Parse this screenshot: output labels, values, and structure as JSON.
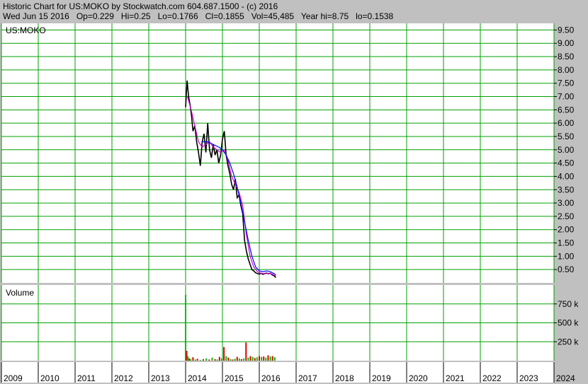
{
  "header": {
    "line1": "Historic Chart for US:MOKO by Stockwatch.com 604.687.1500 - (c) 2016",
    "line2": "Wed Jun 15 2016   Op=0.229   Hi=0.25   Lo=0.1766   Cl=0.1855   Vol=45,485   Year hi=8.75   lo=0.1538"
  },
  "colors": {
    "background": "#c0c0c0",
    "panel": "#ffffff",
    "grid": "#00a000",
    "price": "#000000",
    "ma_short": "#d000d0",
    "ma_long": "#0000ff",
    "volume_up": "#00c000",
    "volume_down": "#e00000"
  },
  "chart_data": [
    {
      "type": "line",
      "title": "US:MOKO",
      "x_unit": "year",
      "xlim": [
        2009,
        2024
      ],
      "ylim": [
        0,
        9.75
      ],
      "y_ticks": [
        "0.50",
        "1.00",
        "1.50",
        "2.00",
        "2.50",
        "3.00",
        "3.50",
        "4.00",
        "4.50",
        "5.00",
        "5.50",
        "6.00",
        "6.50",
        "7.00",
        "7.50",
        "8.00",
        "8.50",
        "9.00",
        "9.50"
      ],
      "grid": true,
      "series": [
        {
          "kind": "price",
          "x": [
            2014.0,
            2014.04,
            2014.08,
            2014.12,
            2014.16,
            2014.2,
            2014.25,
            2014.3,
            2014.35,
            2014.4,
            2014.45,
            2014.5,
            2014.55,
            2014.6,
            2014.65,
            2014.7,
            2014.75,
            2014.8,
            2014.85,
            2014.9,
            2014.95,
            2015.0,
            2015.05,
            2015.1,
            2015.15,
            2015.2,
            2015.25,
            2015.3,
            2015.35,
            2015.4,
            2015.45,
            2015.5,
            2015.55,
            2015.6,
            2015.65,
            2015.7,
            2015.75,
            2015.8,
            2015.85,
            2015.9,
            2015.95,
            2016.0,
            2016.05,
            2016.1,
            2016.15,
            2016.2,
            2016.25,
            2016.3,
            2016.35,
            2016.4,
            2016.45
          ],
          "values": [
            6.6,
            7.6,
            7.0,
            6.7,
            6.3,
            5.7,
            5.9,
            5.3,
            4.9,
            4.4,
            5.3,
            5.6,
            4.9,
            6.0,
            5.0,
            4.7,
            5.2,
            4.8,
            5.0,
            4.5,
            4.8,
            5.4,
            5.7,
            4.8,
            4.4,
            4.1,
            3.7,
            3.5,
            3.9,
            3.2,
            3.3,
            2.9,
            2.6,
            1.6,
            1.2,
            0.9,
            0.7,
            0.5,
            0.45,
            0.38,
            0.35,
            0.33,
            0.36,
            0.32,
            0.35,
            0.37,
            0.34,
            0.36,
            0.3,
            0.27,
            0.2
          ]
        },
        {
          "kind": "moving-average-short",
          "x": [
            2014.05,
            2014.15,
            2014.25,
            2014.35,
            2014.45,
            2014.55,
            2014.65,
            2014.75,
            2014.85,
            2014.95,
            2015.05,
            2015.15,
            2015.25,
            2015.35,
            2015.45,
            2015.55,
            2015.65,
            2015.75,
            2015.85,
            2015.95,
            2016.05,
            2016.15,
            2016.25,
            2016.35,
            2016.45
          ],
          "values": [
            7.0,
            6.5,
            5.9,
            5.3,
            5.1,
            5.2,
            5.3,
            5.1,
            5.0,
            4.9,
            5.0,
            4.6,
            4.0,
            3.7,
            3.4,
            2.9,
            1.8,
            1.0,
            0.6,
            0.42,
            0.36,
            0.34,
            0.36,
            0.33,
            0.26
          ]
        },
        {
          "kind": "moving-average-long",
          "x": [
            2014.45,
            2014.6,
            2014.75,
            2014.9,
            2015.0,
            2015.1,
            2015.2,
            2015.3,
            2015.4,
            2015.5,
            2015.6,
            2015.7,
            2015.8,
            2015.9,
            2016.0,
            2016.1,
            2016.2,
            2016.3,
            2016.4,
            2016.45
          ],
          "values": [
            5.3,
            5.3,
            5.2,
            5.1,
            5.0,
            4.8,
            4.5,
            4.1,
            3.6,
            3.0,
            2.3,
            1.6,
            1.0,
            0.6,
            0.45,
            0.42,
            0.45,
            0.42,
            0.35,
            0.3
          ]
        }
      ]
    },
    {
      "type": "bar",
      "title": "Volume",
      "ylim": [
        0,
        1000000
      ],
      "y_ticks": [
        "250 k",
        "500 k",
        "750 k"
      ],
      "grid": true,
      "x": [
        2014.0,
        2014.03,
        2014.06,
        2014.1,
        2014.14,
        2014.2,
        2014.26,
        2014.32,
        2014.4,
        2014.48,
        2014.56,
        2014.64,
        2014.72,
        2014.8,
        2014.86,
        2014.92,
        2014.98,
        2015.04,
        2015.1,
        2015.16,
        2015.22,
        2015.28,
        2015.34,
        2015.4,
        2015.46,
        2015.52,
        2015.58,
        2015.64,
        2015.7,
        2015.76,
        2015.82,
        2015.88,
        2015.94,
        2016.0,
        2016.06,
        2016.12,
        2016.18,
        2016.24,
        2016.3,
        2016.36,
        2016.42
      ],
      "values": [
        870000,
        130000,
        60000,
        30000,
        20000,
        45000,
        15000,
        25000,
        10000,
        20000,
        30000,
        15000,
        40000,
        20000,
        15000,
        50000,
        30000,
        180000,
        60000,
        40000,
        20000,
        15000,
        25000,
        50000,
        30000,
        20000,
        30000,
        240000,
        40000,
        60000,
        50000,
        35000,
        45000,
        60000,
        50000,
        55000,
        40000,
        70000,
        55000,
        60000,
        45000
      ],
      "direction": [
        "up",
        "down",
        "up",
        "down",
        "up",
        "down",
        "up",
        "down",
        "up",
        "down",
        "up",
        "down",
        "up",
        "down",
        "up",
        "down",
        "up",
        "down",
        "up",
        "down",
        "up",
        "down",
        "up",
        "down",
        "up",
        "down",
        "up",
        "down",
        "up",
        "down",
        "up",
        "down",
        "up",
        "down",
        "up",
        "down",
        "up",
        "down",
        "up",
        "down",
        "up"
      ]
    }
  ],
  "x_axis": {
    "labels": [
      "2009",
      "2010",
      "2011",
      "2012",
      "2013",
      "2014",
      "2015",
      "2016",
      "2017",
      "2018",
      "2019",
      "2020",
      "2021",
      "2022",
      "2023",
      "2024"
    ]
  }
}
